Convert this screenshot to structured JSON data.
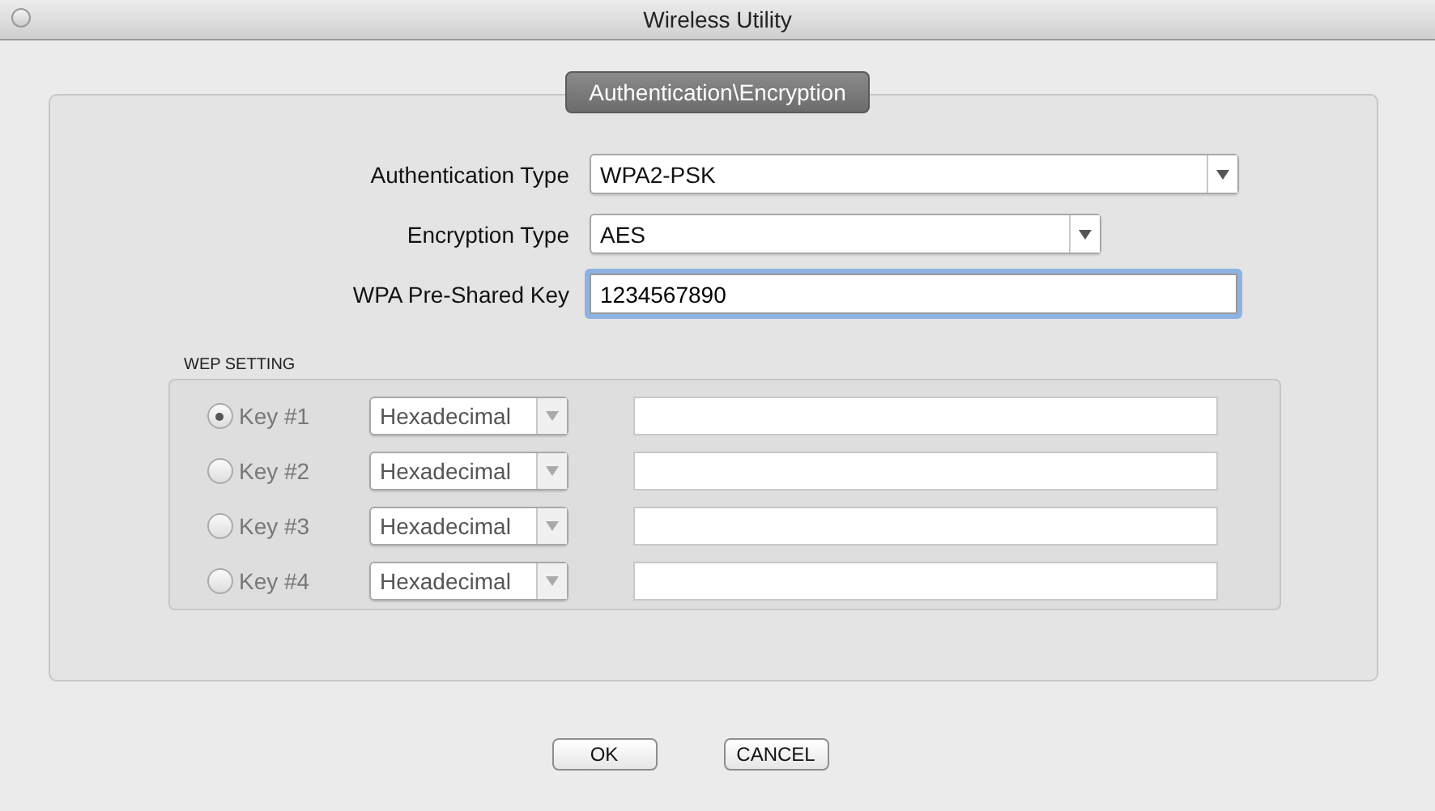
{
  "window": {
    "title": "Wireless Utility"
  },
  "section_tab": {
    "label": "Authentication\\Encryption"
  },
  "fields": [
    {
      "kind": "select",
      "label": "Authentication Type",
      "value": "WPA2-PSK",
      "focused": false
    },
    {
      "kind": "select",
      "label": "Encryption Type",
      "value": "AES",
      "focused": false
    },
    {
      "kind": "input",
      "label": "WPA Pre-Shared Key",
      "value": "1234567890",
      "focused": true
    }
  ],
  "wep": {
    "title": "WEP SETTING",
    "disabled": true,
    "keys": [
      {
        "label": "Key #1",
        "selected": true,
        "format": "Hexadecimal"
      },
      {
        "label": "Key #2",
        "selected": false,
        "format": "Hexadecimal"
      },
      {
        "label": "Key #3",
        "selected": false,
        "format": "Hexadecimal"
      },
      {
        "label": "Key #4",
        "selected": false,
        "format": "Hexadecimal"
      }
    ]
  },
  "buttons": [
    {
      "label": "OK"
    },
    {
      "label": "CANCEL"
    }
  ]
}
